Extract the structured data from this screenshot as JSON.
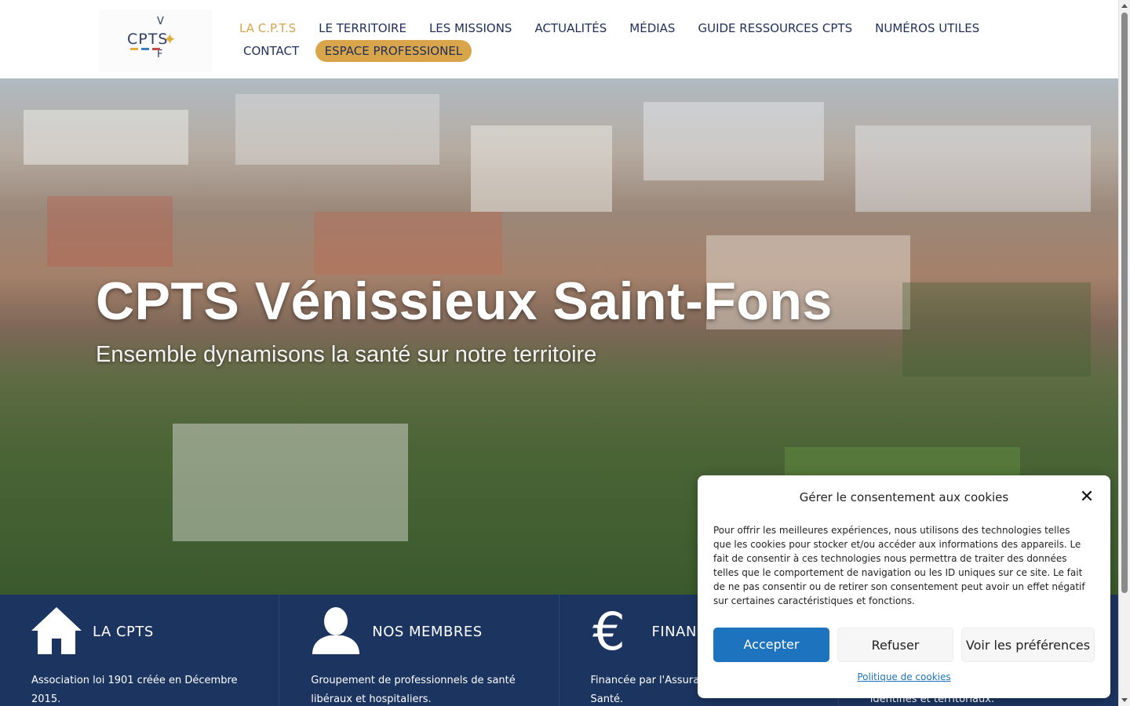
{
  "header": {
    "logo": {
      "main": "CPTS",
      "top_letter": "V",
      "bottom_letter": "F"
    },
    "nav_row1": [
      {
        "label": "LA C.P.T.S",
        "active": true
      },
      {
        "label": "LE TERRITOIRE"
      },
      {
        "label": "LES MISSIONS"
      },
      {
        "label": "ACTUALITÉS"
      },
      {
        "label": "MÉDIAS"
      },
      {
        "label": "GUIDE RESSOURCES CPTS"
      },
      {
        "label": "NUMÉROS UTILES"
      }
    ],
    "nav_row2": [
      {
        "label": "CONTACT"
      },
      {
        "label": "ESPACE PROFESSIONEL",
        "highlight": true
      }
    ]
  },
  "hero": {
    "title": "CPTS Vénissieux Saint-Fons",
    "subtitle": "Ensemble dynamisons la santé sur notre territoire"
  },
  "features": [
    {
      "icon": "home-icon",
      "title": "LA CPTS",
      "text": "Association loi 1901 créée en Décembre 2015."
    },
    {
      "icon": "user-icon",
      "title": "NOS MEMBRES",
      "text": "Groupement de professionnels de santé libéraux et hospitaliers."
    },
    {
      "icon": "euro-icon",
      "title": "FINANC",
      "text": "Financée par l'Assuran Régionale de Santé."
    },
    {
      "icon": "",
      "title": "",
      "text": "identifiés et territoriaux."
    }
  ],
  "cookie_dialog": {
    "title": "Gérer le consentement aux cookies",
    "body": "Pour offrir les meilleures expériences, nous utilisons des technologies telles que les cookies pour stocker et/ou accéder aux informations des appareils. Le fait de consentir à ces technologies nous permettra de traiter des données telles que le comportement de navigation ou les ID uniques sur ce site. Le fait de ne pas consentir ou de retirer son consentement peut avoir un effet négatif sur certaines caractéristiques et fonctions.",
    "accept_label": "Accepter",
    "refuse_label": "Refuser",
    "preferences_label": "Voir les préférences",
    "policy_link": "Politique de cookies"
  },
  "colors": {
    "navy": "#1c3560",
    "gold": "#d9a54a",
    "nav_text": "#1f2f5a",
    "accept_blue": "#1e73be"
  }
}
